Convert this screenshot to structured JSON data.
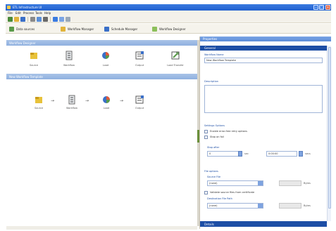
{
  "window": {
    "title": "ETL Infrastructure UI"
  },
  "menu": [
    "File",
    "Edit",
    "Process",
    "Tools",
    "Help"
  ],
  "quick_tabs": [
    "Data sources",
    "Workflow Manager",
    "Schedule Manager",
    "Workflow Designer"
  ],
  "left": {
    "palette_header": "Workflow Designer",
    "palette_items": [
      "Source",
      "Workflow",
      "Load",
      "Output",
      "Load Transfer"
    ],
    "flow_header": "New Workflow Template",
    "flow_items": [
      "Source",
      "Workflow",
      "Load",
      "Output"
    ]
  },
  "props": {
    "title": "Properties",
    "general_header": "General",
    "workflow_name_label": "Workflow Name",
    "workflow_name_value": "New Workflow Template",
    "description_label": "Description",
    "settings_label": "Settings Options",
    "checkbox_1": "Enable error-free retry options",
    "checkbox_2": "Stop on fail",
    "stop_after_label": "Stop after",
    "stop_after_value": "0",
    "stop_after_unit": "sec",
    "time_value": "0:00:00",
    "time_unit": "secs",
    "file_options_label": "File options",
    "source_file_label": "Source File",
    "source_file_value": "(none)",
    "source_size_unit": "Bytes",
    "checkbox_3": "Validate source files from certificate",
    "destination_label": "Destination File Path",
    "destination_value": "(none)",
    "destination_unit": "Bytes",
    "details_header": "Details"
  },
  "colors": {
    "titlebar": "#1f5fcf",
    "general_header": "#1d4ea5",
    "section_header": "#8fb0df"
  }
}
